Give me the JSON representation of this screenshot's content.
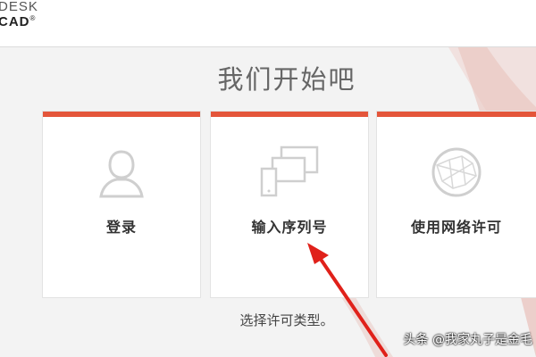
{
  "header": {
    "logo_line1": "DESK",
    "logo_line2": "CAD",
    "logo_mark": "®"
  },
  "main": {
    "title": "我们开始吧",
    "options": [
      {
        "label": "登录",
        "icon": "user-icon"
      },
      {
        "label": "输入序列号",
        "icon": "devices-icon"
      },
      {
        "label": "使用网络许可",
        "icon": "network-globe-icon"
      }
    ],
    "prompt": "选择许可类型。"
  },
  "overlay": {
    "watermark": "头条 @我家丸子是金毛"
  },
  "colors": {
    "accent": "#e4553a",
    "annotation_arrow": "#e0211a"
  }
}
